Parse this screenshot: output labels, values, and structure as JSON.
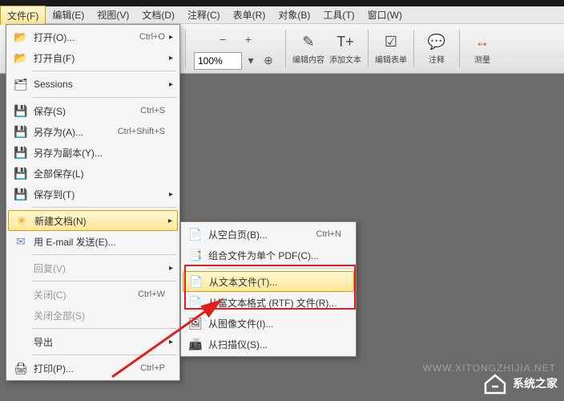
{
  "menubar": [
    {
      "label": "文件(F)",
      "active": true
    },
    {
      "label": "编辑(E)"
    },
    {
      "label": "视图(V)"
    },
    {
      "label": "文档(D)"
    },
    {
      "label": "注释(C)"
    },
    {
      "label": "表单(R)"
    },
    {
      "label": "对象(B)"
    },
    {
      "label": "工具(T)"
    },
    {
      "label": "窗口(W)"
    }
  ],
  "toolbar": {
    "zoom_value": "100%",
    "groups": [
      {
        "label": "编辑内容"
      },
      {
        "label": "添加文本"
      },
      {
        "label": "编辑表单"
      },
      {
        "label": "注释"
      },
      {
        "label": "测量"
      }
    ]
  },
  "file_menu": [
    {
      "icon": "📂",
      "label": "打开(O)...",
      "shortcut": "Ctrl+O",
      "arrow": true,
      "cls": "folder-icon"
    },
    {
      "icon": "📂",
      "label": "打开自(F)",
      "arrow": true,
      "cls": "folder-icon"
    },
    {
      "sep": true
    },
    {
      "icon": "🗂",
      "label": "Sessions",
      "arrow": true
    },
    {
      "sep": true
    },
    {
      "icon": "💾",
      "label": "保存(S)",
      "shortcut": "Ctrl+S",
      "cls": "disk-icon"
    },
    {
      "icon": "💾",
      "label": "另存为(A)...",
      "shortcut": "Ctrl+Shift+S",
      "cls": "disk-icon"
    },
    {
      "icon": "💾",
      "label": "另存为副本(Y)...",
      "cls": "disk-icon"
    },
    {
      "icon": "💾",
      "label": "全部保存(L)",
      "cls": "disk-icon"
    },
    {
      "icon": "💾",
      "label": "保存到(T)",
      "arrow": true,
      "cls": "disk-icon"
    },
    {
      "sep": true
    },
    {
      "icon": "✳",
      "label": "新建文档(N)",
      "arrow": true,
      "highlighted": true,
      "cls": "new-icon"
    },
    {
      "icon": "✉",
      "label": "用 E-mail 发送(E)...",
      "cls": "doc-icon"
    },
    {
      "sep": true
    },
    {
      "label": "回复(V)",
      "arrow": true,
      "disabled": true
    },
    {
      "sep": true
    },
    {
      "label": "关闭(C)",
      "shortcut": "Ctrl+W",
      "disabled": true
    },
    {
      "label": "关闭全部(S)",
      "disabled": true
    },
    {
      "sep": true
    },
    {
      "label": "导出",
      "arrow": true
    },
    {
      "sep": true
    },
    {
      "icon": "🖨",
      "label": "打印(P)...",
      "shortcut": "Ctrl+P"
    }
  ],
  "submenu": [
    {
      "icon": "📄",
      "label": "从空白页(B)...",
      "shortcut": "Ctrl+N"
    },
    {
      "icon": "📑",
      "label": "组合文件为单个 PDF(C)..."
    },
    {
      "sep": true
    },
    {
      "icon": "📄",
      "label": "从文本文件(T)...",
      "highlighted": true,
      "box": true
    },
    {
      "icon": "📄",
      "label": "从富文本格式 (RTF) 文件(R)..."
    },
    {
      "icon": "🖼",
      "label": "从图像文件(I)..."
    },
    {
      "icon": "📠",
      "label": "从扫描仪(S)..."
    }
  ],
  "watermark": {
    "brand": "系统之家",
    "url": "WWW.XITONGZHIJIA.NET"
  }
}
